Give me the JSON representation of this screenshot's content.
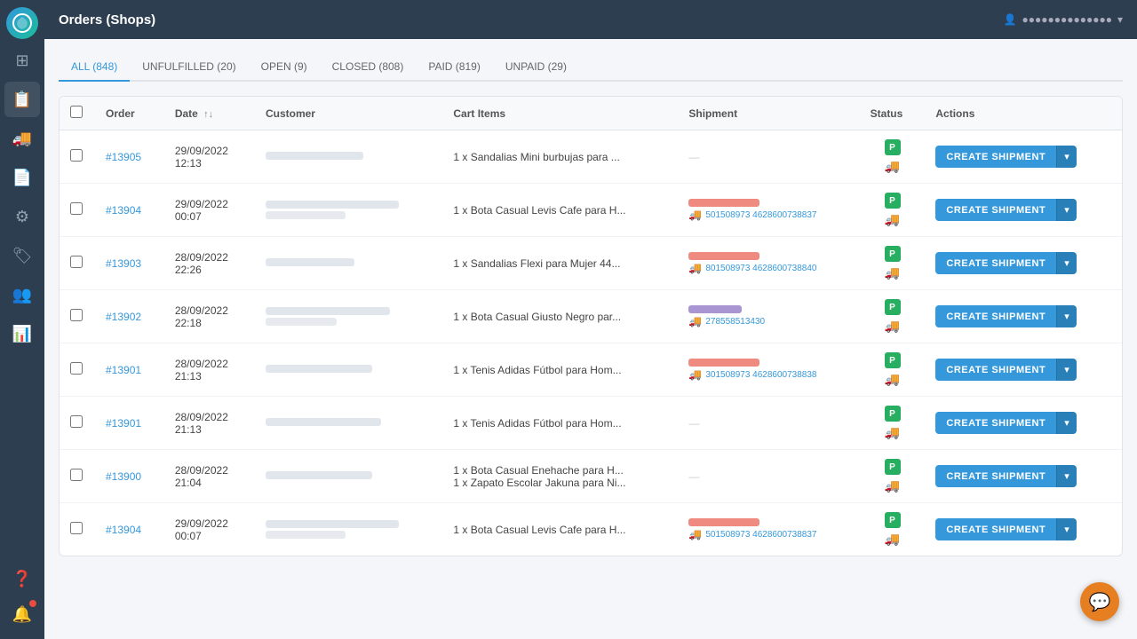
{
  "topbar": {
    "title": "Orders (Shops)",
    "user": "●●●●●●●●●●●●●●"
  },
  "tabs": [
    {
      "id": "all",
      "label": "ALL (848)",
      "active": true
    },
    {
      "id": "unfulfilled",
      "label": "UNFULFILLED (20)",
      "active": false
    },
    {
      "id": "open",
      "label": "OPEN (9)",
      "active": false
    },
    {
      "id": "closed",
      "label": "CLOSED (808)",
      "active": false
    },
    {
      "id": "paid",
      "label": "PAID (819)",
      "active": false
    },
    {
      "id": "unpaid",
      "label": "UNPAID (29)",
      "active": false
    }
  ],
  "table": {
    "headers": [
      "",
      "Order",
      "Date",
      "Customer",
      "Cart Items",
      "Shipment",
      "Status",
      "Actions"
    ],
    "sort_label": "↑↓"
  },
  "orders": [
    {
      "id": "13905",
      "order_num": "#13905",
      "date": "29/09/2022",
      "time": "12:13",
      "cart_item": "1 x Sandalias Mini burbujas para ...",
      "shipment_type": "none",
      "tracking": "",
      "create_btn": "CREATE SHIPMENT"
    },
    {
      "id": "13904a",
      "order_num": "#13904",
      "date": "29/09/2022",
      "time": "00:07",
      "cart_item": "1 x Bota Casual Levis Cafe para H...",
      "shipment_type": "red_tracking",
      "tracking": "501508973 4628600738837",
      "create_btn": "CREATE SHIPMENT"
    },
    {
      "id": "13903",
      "order_num": "#13903",
      "date": "28/09/2022",
      "time": "22:26",
      "cart_item": "1 x Sandalias Flexi para Mujer 44...",
      "shipment_type": "red_tracking",
      "tracking": "801508973 4628600738840",
      "create_btn": "CREATE SHIPMENT"
    },
    {
      "id": "13902",
      "order_num": "#13902",
      "date": "28/09/2022",
      "time": "22:18",
      "cart_item": "1 x Bota Casual Giusto Negro par...",
      "shipment_type": "purple_tracking",
      "tracking": "278558513430",
      "create_btn": "CREATE SHIPMENT"
    },
    {
      "id": "13901a",
      "order_num": "#13901",
      "date": "28/09/2022",
      "time": "21:13",
      "cart_item": "1 x Tenis Adidas Fútbol para Hom...",
      "shipment_type": "red_tracking",
      "tracking": "301508973 4628600738838",
      "create_btn": "CREATE SHIPMENT"
    },
    {
      "id": "13901b",
      "order_num": "#13901",
      "date": "28/09/2022",
      "time": "21:13",
      "cart_item": "1 x Tenis Adidas Fútbol para Hom...",
      "shipment_type": "none",
      "tracking": "",
      "create_btn": "CREATE SHIPMENT"
    },
    {
      "id": "13900",
      "order_num": "#13900",
      "date": "28/09/2022",
      "time": "21:04",
      "cart_item": "1 x Bota Casual Enehache para H... / 1 x Zapato Escolar Jakuna para Ni...",
      "shipment_type": "none",
      "tracking": "",
      "create_btn": "CREATE SHIPMENT"
    },
    {
      "id": "13904b",
      "order_num": "#13904",
      "date": "29/09/2022",
      "time": "00:07",
      "cart_item": "1 x Bota Casual Levis Cafe para H...",
      "shipment_type": "red_tracking",
      "tracking": "501508973 4628600738837",
      "create_btn": "CREATE SHIPMENT"
    }
  ],
  "sidebar": {
    "items": [
      {
        "icon": "⊞",
        "name": "dashboard",
        "label": "Dashboard"
      },
      {
        "icon": "📋",
        "name": "orders",
        "label": "Orders",
        "active": true
      },
      {
        "icon": "🚚",
        "name": "shipping",
        "label": "Shipping"
      },
      {
        "icon": "📄",
        "name": "documents",
        "label": "Documents"
      },
      {
        "icon": "⚙",
        "name": "settings",
        "label": "Settings"
      },
      {
        "icon": "🏷",
        "name": "tags",
        "label": "Tags"
      },
      {
        "icon": "👥",
        "name": "users",
        "label": "Users"
      },
      {
        "icon": "📊",
        "name": "reports",
        "label": "Reports"
      },
      {
        "icon": "❓",
        "name": "help",
        "label": "Help"
      }
    ]
  },
  "chat": {
    "icon": "💬",
    "label": "Chat"
  }
}
